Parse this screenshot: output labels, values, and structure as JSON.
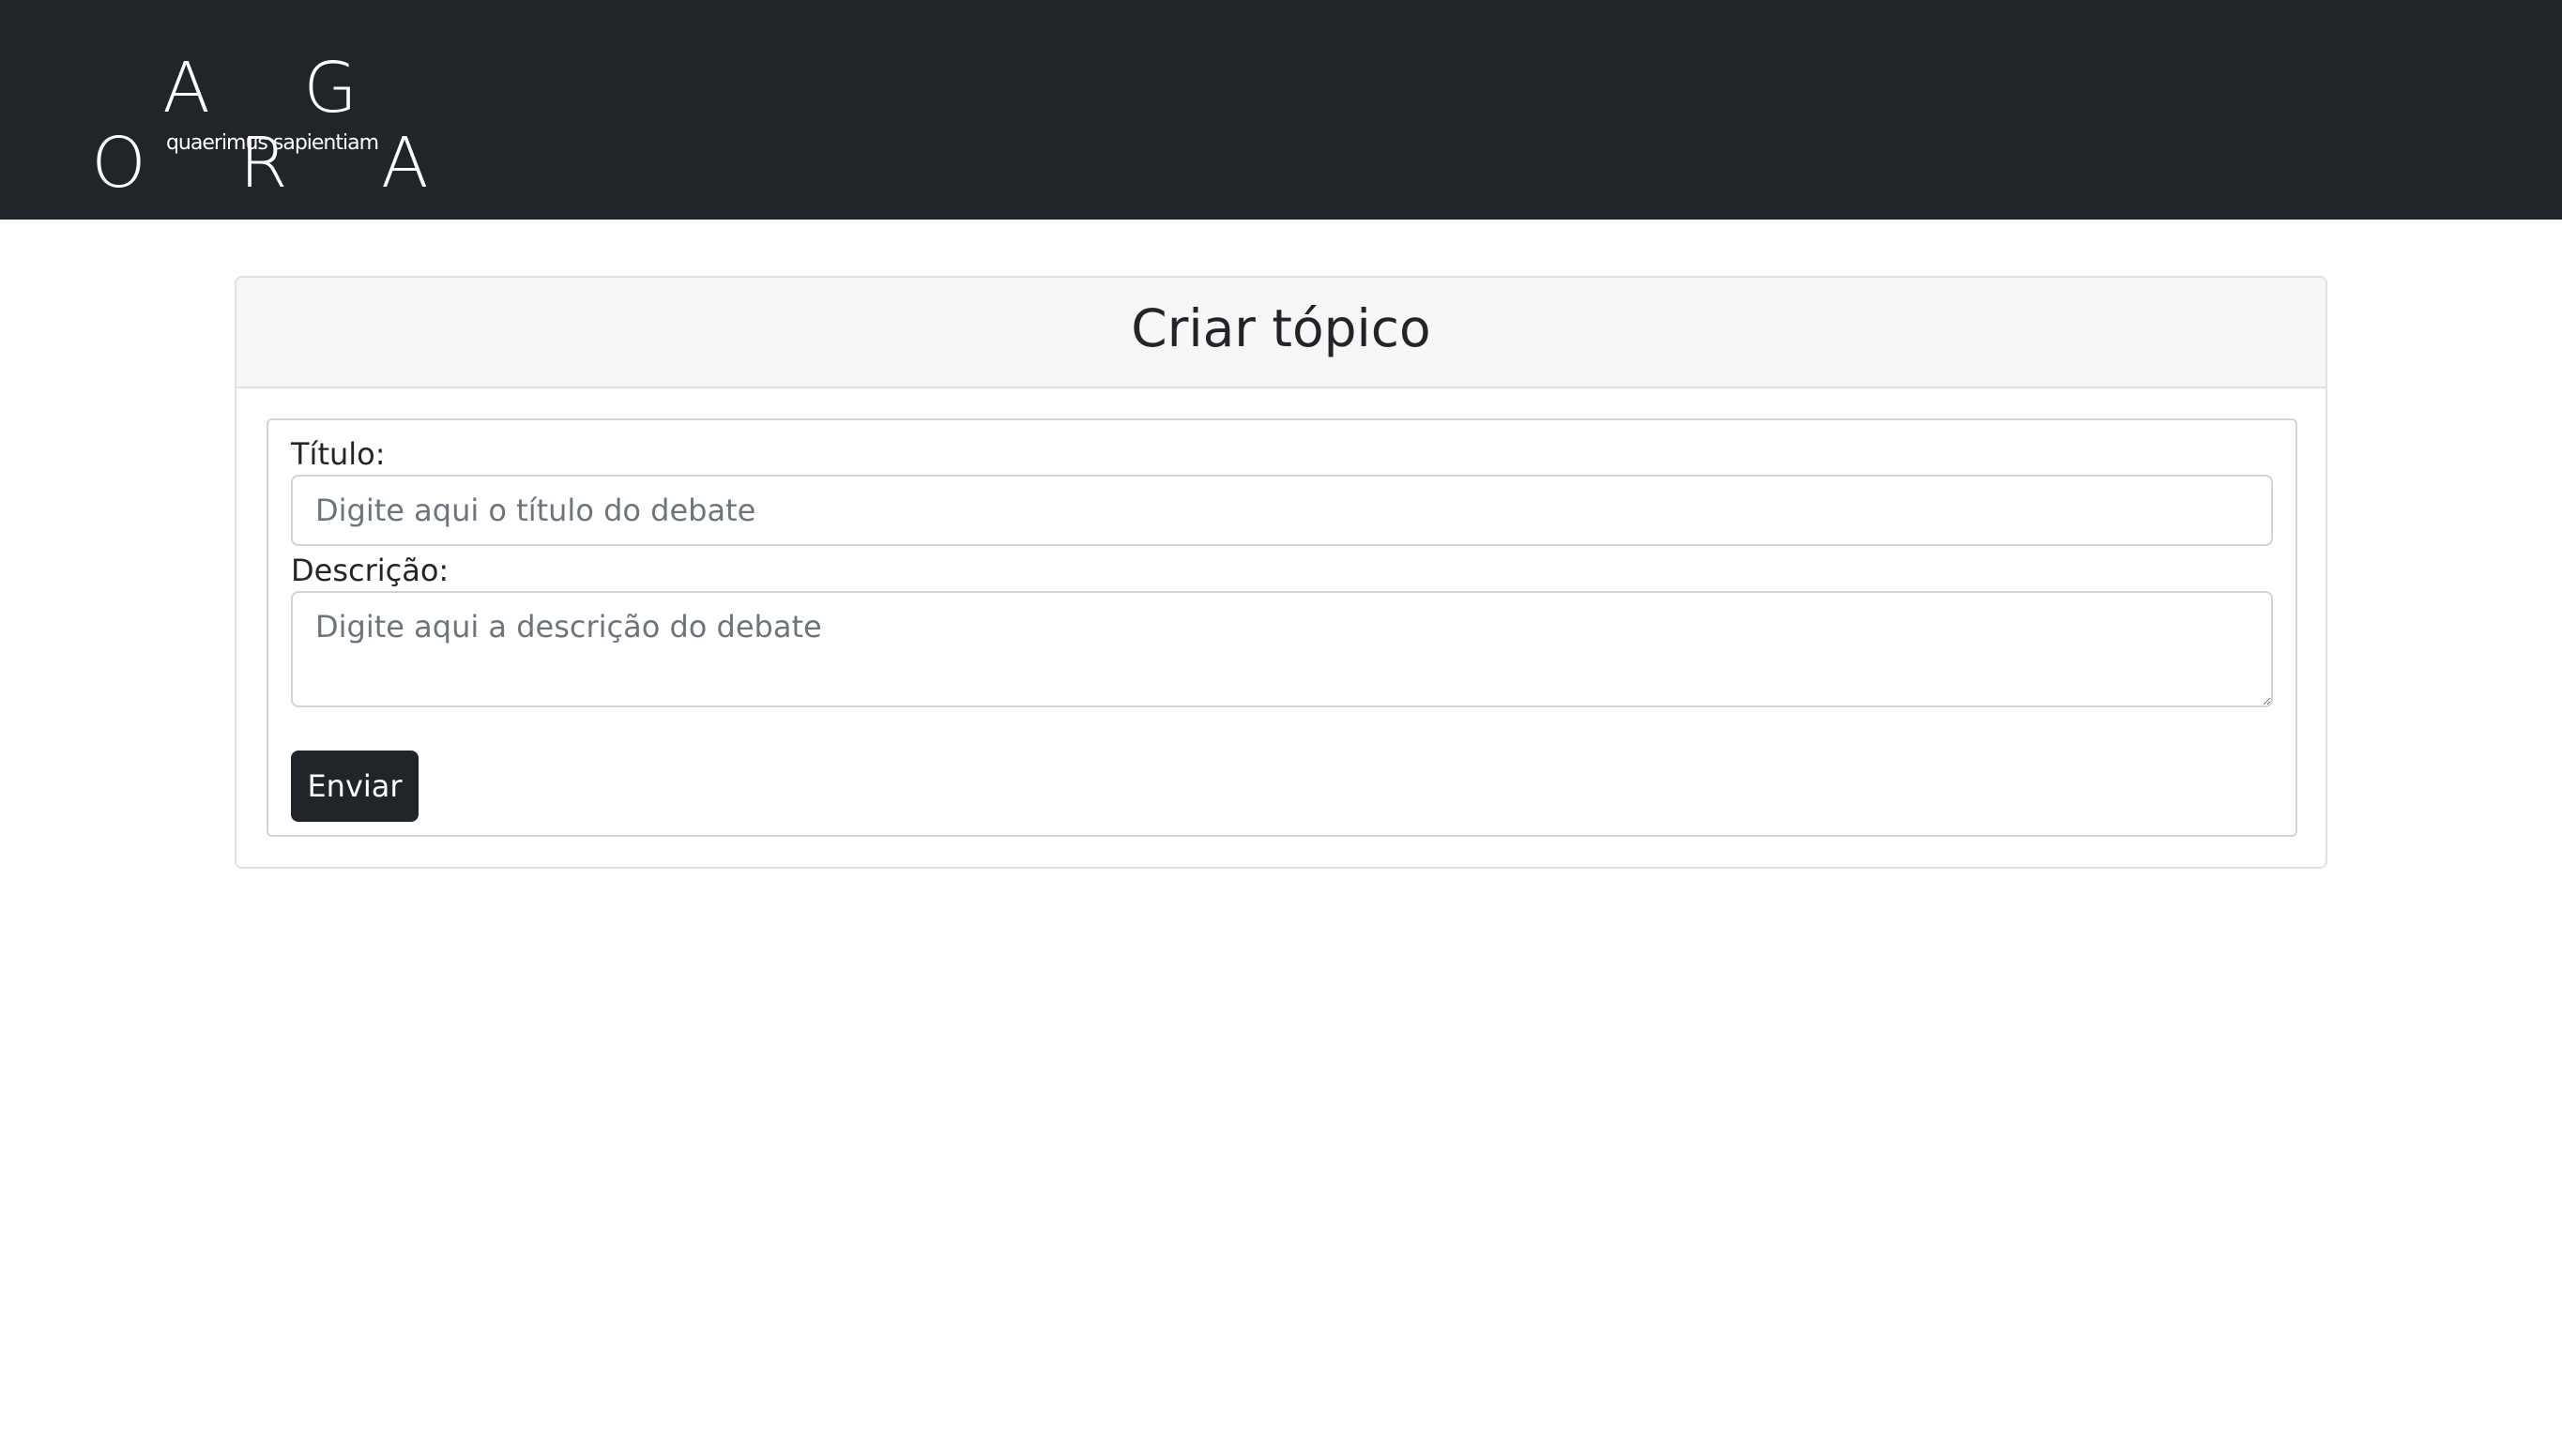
{
  "header": {
    "logo_text": "A G O R A",
    "logo_tagline": "quaerimus sapientiam"
  },
  "card": {
    "title": "Criar tópico"
  },
  "form": {
    "title_label": "Título:",
    "title_placeholder": "Digite aqui o título do debate",
    "title_value": "",
    "description_label": "Descrição:",
    "description_placeholder": "Digite aqui a descrição do debate",
    "description_value": "",
    "submit_label": "Enviar"
  },
  "colors": {
    "navbar_bg": "#212529",
    "button_bg": "#212529",
    "card_header_bg": "#f7f7f7",
    "border": "#dee2e6",
    "placeholder": "#6c757d"
  }
}
